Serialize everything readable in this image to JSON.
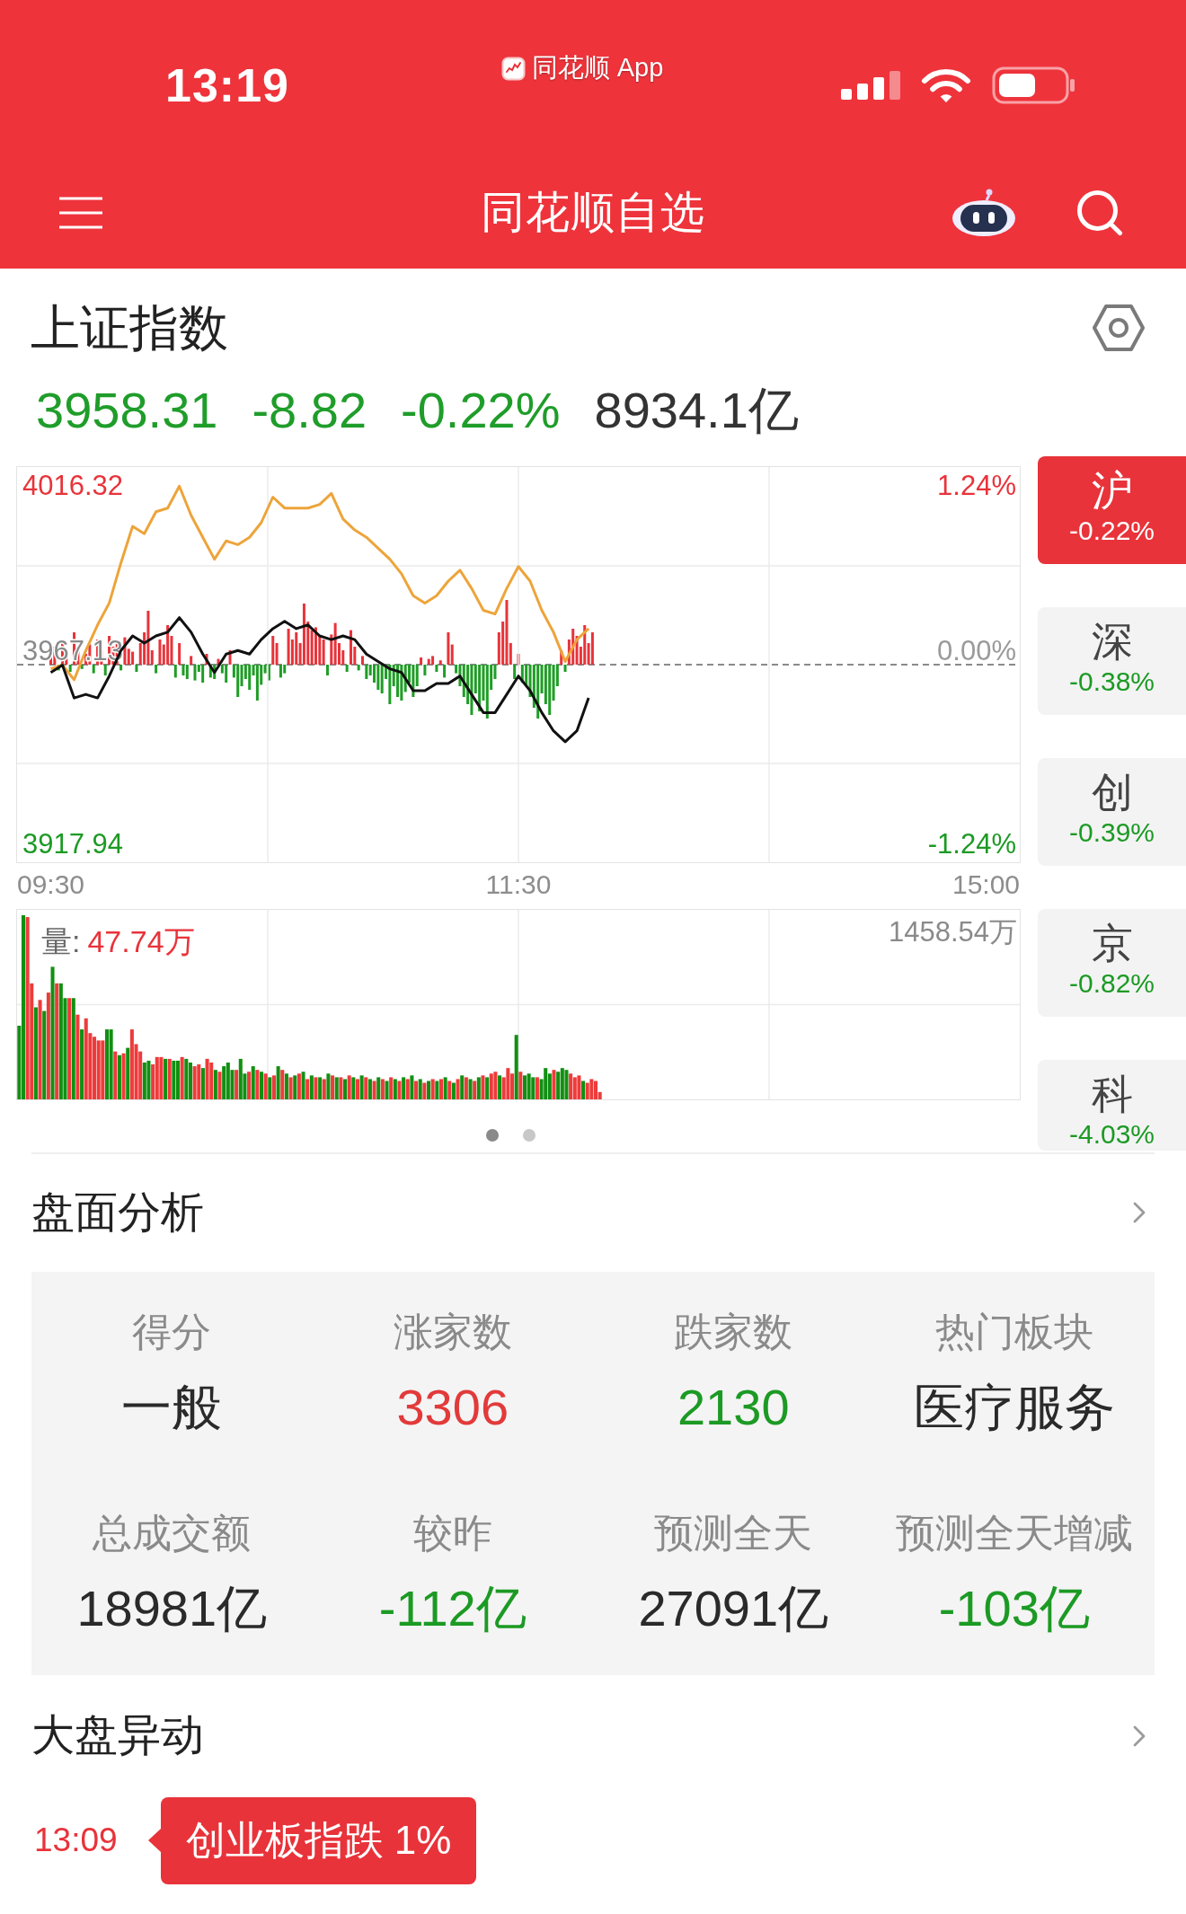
{
  "status_bar": {
    "time": "13:19",
    "app_label": "同花顺 App"
  },
  "nav_bar": {
    "title": "同花顺自选"
  },
  "index_header": {
    "name": "上证指数",
    "quote": [
      {
        "text": "3958.31",
        "color": "#1f9d2a"
      },
      {
        "text": "-8.82",
        "color": "#1f9d2a"
      },
      {
        "text": "-0.22%",
        "color": "#1f9d2a"
      },
      {
        "text": "8934.1亿",
        "color": "#333333"
      }
    ]
  },
  "intraday_chart": {
    "prev_close_label": "3967.13",
    "percent_labels": [
      {
        "text": "1.24%",
        "color": "#e8333a"
      },
      {
        "text": "0.00%",
        "color": "#9a9a9a"
      },
      {
        "text": "-1.24%",
        "color": "#1c9a24"
      }
    ],
    "chart_data": {
      "type": "line",
      "categories": [
        "09:30",
        null,
        null,
        null,
        null,
        null,
        null,
        null,
        null,
        null,
        null,
        null,
        null,
        null,
        null,
        null,
        null,
        null,
        null,
        null,
        null,
        null,
        null,
        null,
        null,
        null,
        null,
        null,
        null,
        null,
        null,
        null,
        null,
        null,
        null,
        null,
        null,
        null,
        null,
        null,
        "11:30",
        null,
        null,
        null,
        null,
        null,
        null,
        null,
        null,
        null,
        null,
        null,
        null,
        null,
        null,
        null,
        null,
        null,
        null,
        null,
        null,
        null,
        null,
        null,
        null,
        null,
        null,
        null,
        null,
        null,
        null,
        null,
        null,
        null,
        null,
        null,
        null,
        null,
        null,
        null,
        "15:00"
      ],
      "ylim": [
        3913.02,
        4021.24
      ],
      "yticks": [
        {
          "value": 3917.94,
          "label": "3917.94"
        },
        {
          "value": 4016.32,
          "label": "4016.32"
        }
      ],
      "series": [
        {
          "color": "#eda43a",
          "values": [
            3966,
            3967,
            3963,
            3971,
            3978,
            3984,
            3995,
            4005,
            4003,
            4009,
            4010,
            4016,
            4008,
            4002,
            3996,
            4001,
            4000,
            4002,
            4006,
            4013,
            4010,
            4010,
            4010,
            4011,
            4014,
            4007,
            4004,
            4002,
            3999,
            3996,
            3992,
            3986,
            3984,
            3986,
            3990,
            3993,
            3988,
            3982,
            3981,
            3988,
            3994,
            3990,
            3982,
            3976,
            3968,
            3974,
            3977,
            null,
            null,
            null,
            null,
            null,
            null,
            null,
            null,
            null,
            null,
            null,
            null,
            null,
            null,
            null,
            null,
            null,
            null,
            null,
            null,
            null,
            null,
            null,
            null,
            null,
            null,
            null,
            null,
            null,
            null,
            null,
            null,
            null,
            null
          ]
        },
        {
          "color": "#111111",
          "values": [
            3965,
            3967,
            3958,
            3959,
            3958,
            3964,
            3971,
            3975,
            3973,
            3975,
            3976,
            3980,
            3976,
            3970,
            3965,
            3970,
            3971,
            3970,
            3974,
            3977,
            3979,
            3977,
            3978,
            3975,
            3974,
            3975,
            3974,
            3970,
            3968,
            3966,
            3965,
            3960,
            3960,
            3962,
            3962,
            3964,
            3959,
            3954,
            3954,
            3959,
            3964,
            3960,
            3954,
            3949,
            3946,
            3949,
            3958,
            null,
            null,
            null,
            null,
            null,
            null,
            null,
            null,
            null,
            null,
            null,
            null,
            null,
            null,
            null,
            null,
            null,
            null,
            null,
            null,
            null,
            null,
            null,
            null,
            null,
            null,
            null,
            null,
            null,
            null,
            null,
            null,
            null,
            null
          ]
        }
      ]
    }
  },
  "volume_chart": {
    "label": "量:",
    "value": "47.74万",
    "max_label": "1458.54万"
  },
  "pager": [
    {
      "selected": true
    },
    {
      "selected": false
    }
  ],
  "index_tabs": [
    {
      "name": "沪",
      "change": "-0.22%",
      "selected": true
    },
    {
      "name": "深",
      "change": "-0.38%",
      "selected": false
    },
    {
      "name": "创",
      "change": "-0.39%",
      "selected": false
    },
    {
      "name": "京",
      "change": "-0.82%",
      "selected": false
    },
    {
      "name": "科",
      "change": "-4.03%",
      "selected": false
    }
  ],
  "market_analysis": {
    "title": "盘面分析",
    "stats": [
      {
        "label": "得分",
        "value": "一般",
        "color": "#2a2a2a"
      },
      {
        "label": "涨家数",
        "value": "3306",
        "color": "#e23a3a"
      },
      {
        "label": "跌家数",
        "value": "2130",
        "color": "#1c9a24"
      },
      {
        "label": "热门板块",
        "value": "医疗服务",
        "color": "#2a2a2a"
      },
      {
        "label": "总成交额",
        "value": "18981亿",
        "color": "#2a2a2a"
      },
      {
        "label": "较昨",
        "value": "-112亿",
        "color": "#1c9a24"
      },
      {
        "label": "预测全天",
        "value": "27091亿",
        "color": "#2a2a2a"
      },
      {
        "label": "预测全天增减",
        "value": "-103亿",
        "color": "#1c9a24"
      }
    ]
  },
  "market_moves": {
    "title": "大盘异动",
    "events": [
      {
        "time": "13:09",
        "text": "创业板指跌 1%"
      }
    ]
  }
}
